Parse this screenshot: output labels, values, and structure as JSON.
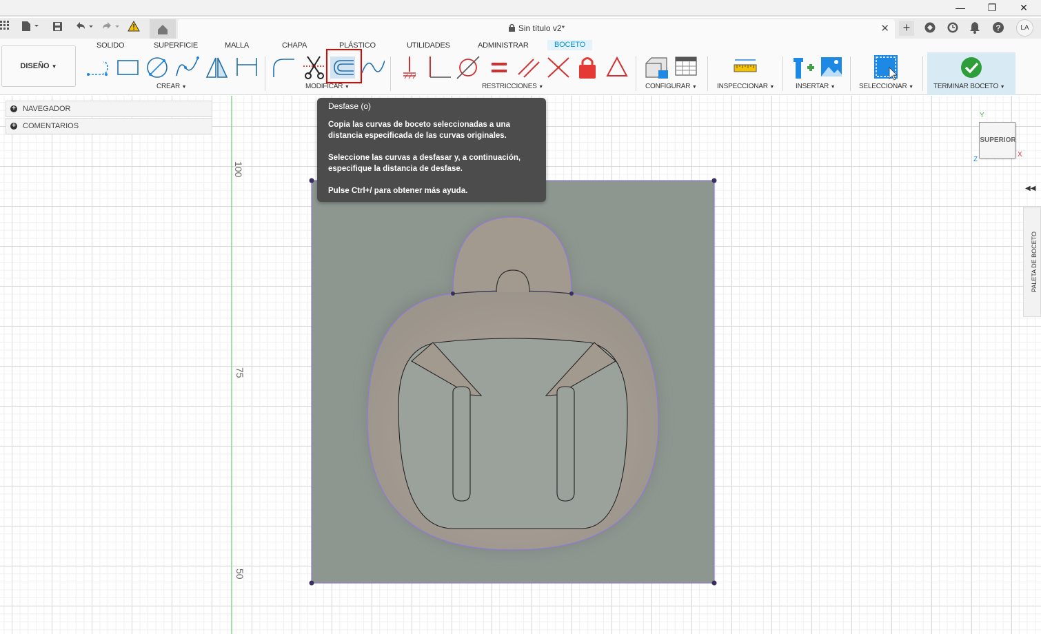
{
  "window": {
    "minimize_icon": "minimize-icon",
    "maximize_icon": "restore-icon",
    "close_icon": "close-icon"
  },
  "appbar": {
    "document_title": "Sin título v2*",
    "user_initials": "LA"
  },
  "ribbon": {
    "design_label": "DISEÑO",
    "tabs": [
      {
        "label": "SOLIDO"
      },
      {
        "label": "SUPERFICIE"
      },
      {
        "label": "MALLA"
      },
      {
        "label": "CHAPA"
      },
      {
        "label": "PLÁSTICO"
      },
      {
        "label": "UTILIDADES"
      },
      {
        "label": "ADMINISTRAR"
      },
      {
        "label": "BOCETO"
      }
    ],
    "active_tab": "BOCETO",
    "groups": {
      "crear": "CREAR",
      "modificar": "MODIFICAR",
      "restricciones": "RESTRICCIONES",
      "configurar": "CONFIGURAR",
      "inspeccionar": "INSPECCIONAR",
      "insertar": "INSERTAR",
      "seleccionar": "SELECCIONAR",
      "terminar": "TERMINAR BOCETO"
    }
  },
  "browser": {
    "navegador": "NAVEGADOR",
    "comentarios": "COMENTARIOS"
  },
  "tooltip": {
    "title": "Desfase (o)",
    "line1": "Copia las curvas de boceto seleccionadas a una distancia especificada de las curvas originales.",
    "line2": "Seleccione las curvas a desfasar y, a continuación, especifique la distancia de desfase.",
    "line3": "Pulse Ctrl+/ para obtener más ayuda."
  },
  "canvas": {
    "ruler_labels": [
      "100",
      "75",
      "50"
    ],
    "viewcube_label": "SUPERIOR",
    "axis_y": "Y",
    "axis_x": "X",
    "axis_z": "Z",
    "palette_label": "PALETA DE BOCETO"
  },
  "colors": {
    "accent": "#0696d7",
    "highlight": "#e10600",
    "sketch_fill": "#8d9790",
    "body_fill": "#a39a8f"
  }
}
